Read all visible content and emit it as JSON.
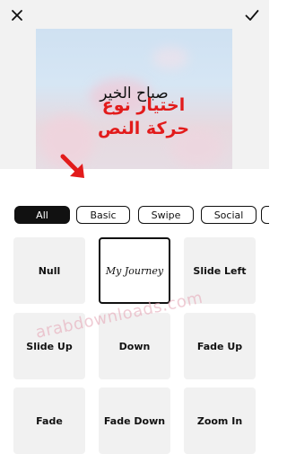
{
  "header": {
    "close_icon": "close-icon",
    "confirm_icon": "checkmark-icon"
  },
  "preview": {
    "text": "صباح الخير",
    "caption_line1": "اختيار نوع",
    "caption_line2": "حركة النص",
    "arrow_color": "#e21b1b"
  },
  "tabs": [
    {
      "label": "All",
      "active": true
    },
    {
      "label": "Basic",
      "active": false
    },
    {
      "label": "Swipe",
      "active": false
    },
    {
      "label": "Social",
      "active": false
    },
    {
      "label": "",
      "active": false
    }
  ],
  "animations": [
    {
      "label": "Null"
    },
    {
      "label": "My Journey",
      "selected": true
    },
    {
      "label": "Slide Left"
    },
    {
      "label": "Slide Up"
    },
    {
      "label": "Down"
    },
    {
      "label": "Fade Up"
    },
    {
      "label": "Fade"
    },
    {
      "label": "Fade Down"
    },
    {
      "label": "Zoom In"
    }
  ],
  "watermark": "arabdownloads.com",
  "colors": {
    "accent": "#111111",
    "overlay_text": "#e21b1b",
    "tile_bg": "#f1f1f1"
  }
}
